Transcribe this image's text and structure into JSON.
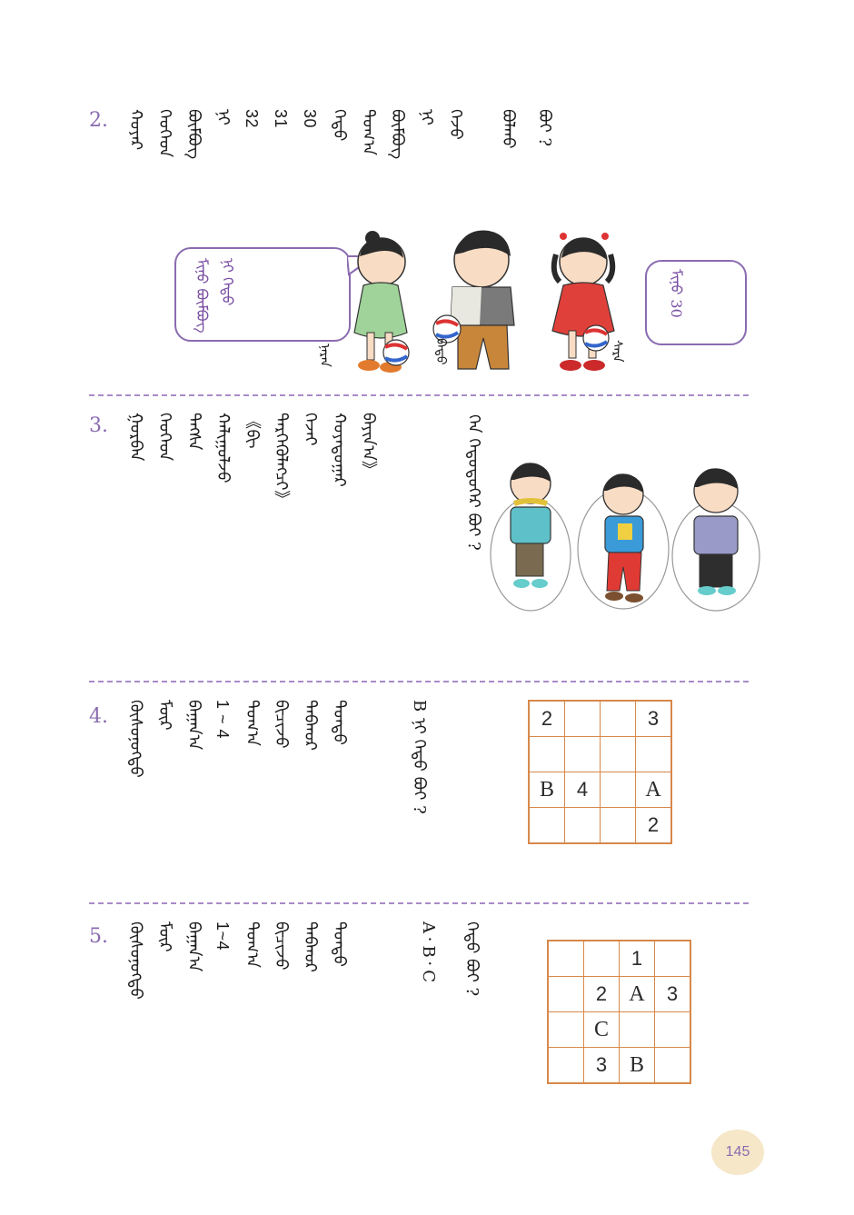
{
  "questions": [
    {
      "number": "2.",
      "script_columns": [
        "ᠬᠣᠶᠠᠷ",
        "ᠬᠡᠦᠬᠡᠳ",
        "ᠪᠥᠮᠪᠦᠭ",
        "ᠨᠢ",
        "32",
        "31",
        "30",
        "ᠬᠡᠳᠦ",
        "ᠲᠣᠭ᠎ᠠ",
        "ᠪᠥᠮᠪᠦᠭ",
        "ᠨᠢ",
        "ᠭᠡᠵᠦ",
        "ᠪᠣᠯᠬᠤ",
        "ᠪᠣᠢ ?"
      ],
      "numbers_in_text": [
        "32",
        "31",
        "30"
      ],
      "bubble_left": "ᠮᠢᠨᠦ ᠪᠥᠮᠪᠦᠭ ᠨᠢ ᠬᠡᠳᠦ",
      "bubble_right": "ᠮᠢᠨᠦ 30",
      "bubble_right_number": "30",
      "kid_labels": [
        "ᠨᠠᠷᠠᠨ",
        "ᠪᠠᠲᠤ",
        "ᠰᠠᠷᠠ"
      ]
    },
    {
      "number": "3.",
      "script_columns": [
        "ᠭᠤᠷᠪᠠᠨ",
        "ᠬᠡᠦᠬᠡᠳ",
        "ᠳᠡᠭᠰᠡ",
        "ᠬᠠᠯᠢᠭᠤᠯᠵᠤ",
        "《ᠪᠢ",
        "ᠲᠡᠷᠭᠡᠭᠦᠯᠡᠭᠴᠢ》",
        "ᠭᠡᠵᠡᠢ",
        "ᠬᠤᠶᠠᠳᠤᠭᠠᠷ",
        "ᠪᠠᠶᠢᠨ᠎ᠠ》",
        "ᠬᠡᠨ ᠬᠡᠳᠦᠳᠦᠭᠡᠷ ᠪᠣᠢ ?"
      ]
    },
    {
      "number": "4.",
      "script_columns": [
        "ᠬᠦᠰᠦᠨᠦᠭᠲᠦ",
        "ᠮᠥᠷ",
        "ᠪᠠᠭᠠᠨ᠎ᠠ",
        "1 ~ 4",
        "ᠲᠣᠭ᠎ᠠ",
        "ᠪᠢᠴᠢᠵᠦ",
        "ᠳᠠᠪᠬᠤᠷ",
        "ᠳᠤᠨᠳᠤ",
        "B ᠨᠢ ᠬᠡᠳᠦ ᠪᠣᠢ ?"
      ],
      "range": "1 ~ 4",
      "grid": [
        [
          "2",
          "",
          "",
          "3"
        ],
        [
          "",
          "",
          "",
          ""
        ],
        [
          "B",
          "4",
          "",
          "A"
        ],
        [
          "",
          "",
          "",
          "2"
        ]
      ]
    },
    {
      "number": "5.",
      "script_columns": [
        "ᠬᠦᠰᠦᠨᠦᠭᠲᠦ",
        "ᠮᠥᠷ",
        "ᠪᠠᠭᠠᠨ᠎ᠠ",
        "1~4",
        "ᠲᠣᠭ᠎ᠠ",
        "ᠪᠢᠴᠢᠵᠦ",
        "ᠳᠠᠪᠬᠤᠷ",
        "ᠳᠤᠨᠳᠤ",
        "A᠂ B᠂ C",
        "ᠬᠡᠳᠦ ᠪᠣᠢ ?"
      ],
      "range": "1~4",
      "letters": "B、C",
      "grid": [
        [
          "",
          "",
          "1",
          ""
        ],
        [
          "",
          "2",
          "A",
          "3"
        ],
        [
          "",
          "C",
          "",
          ""
        ],
        [
          "",
          "3",
          "B",
          ""
        ]
      ]
    }
  ],
  "page_number": "145",
  "colors": {
    "accent": "#8a6bb0",
    "grid_line": "#d7884a",
    "badge": "#f6e7c9"
  }
}
